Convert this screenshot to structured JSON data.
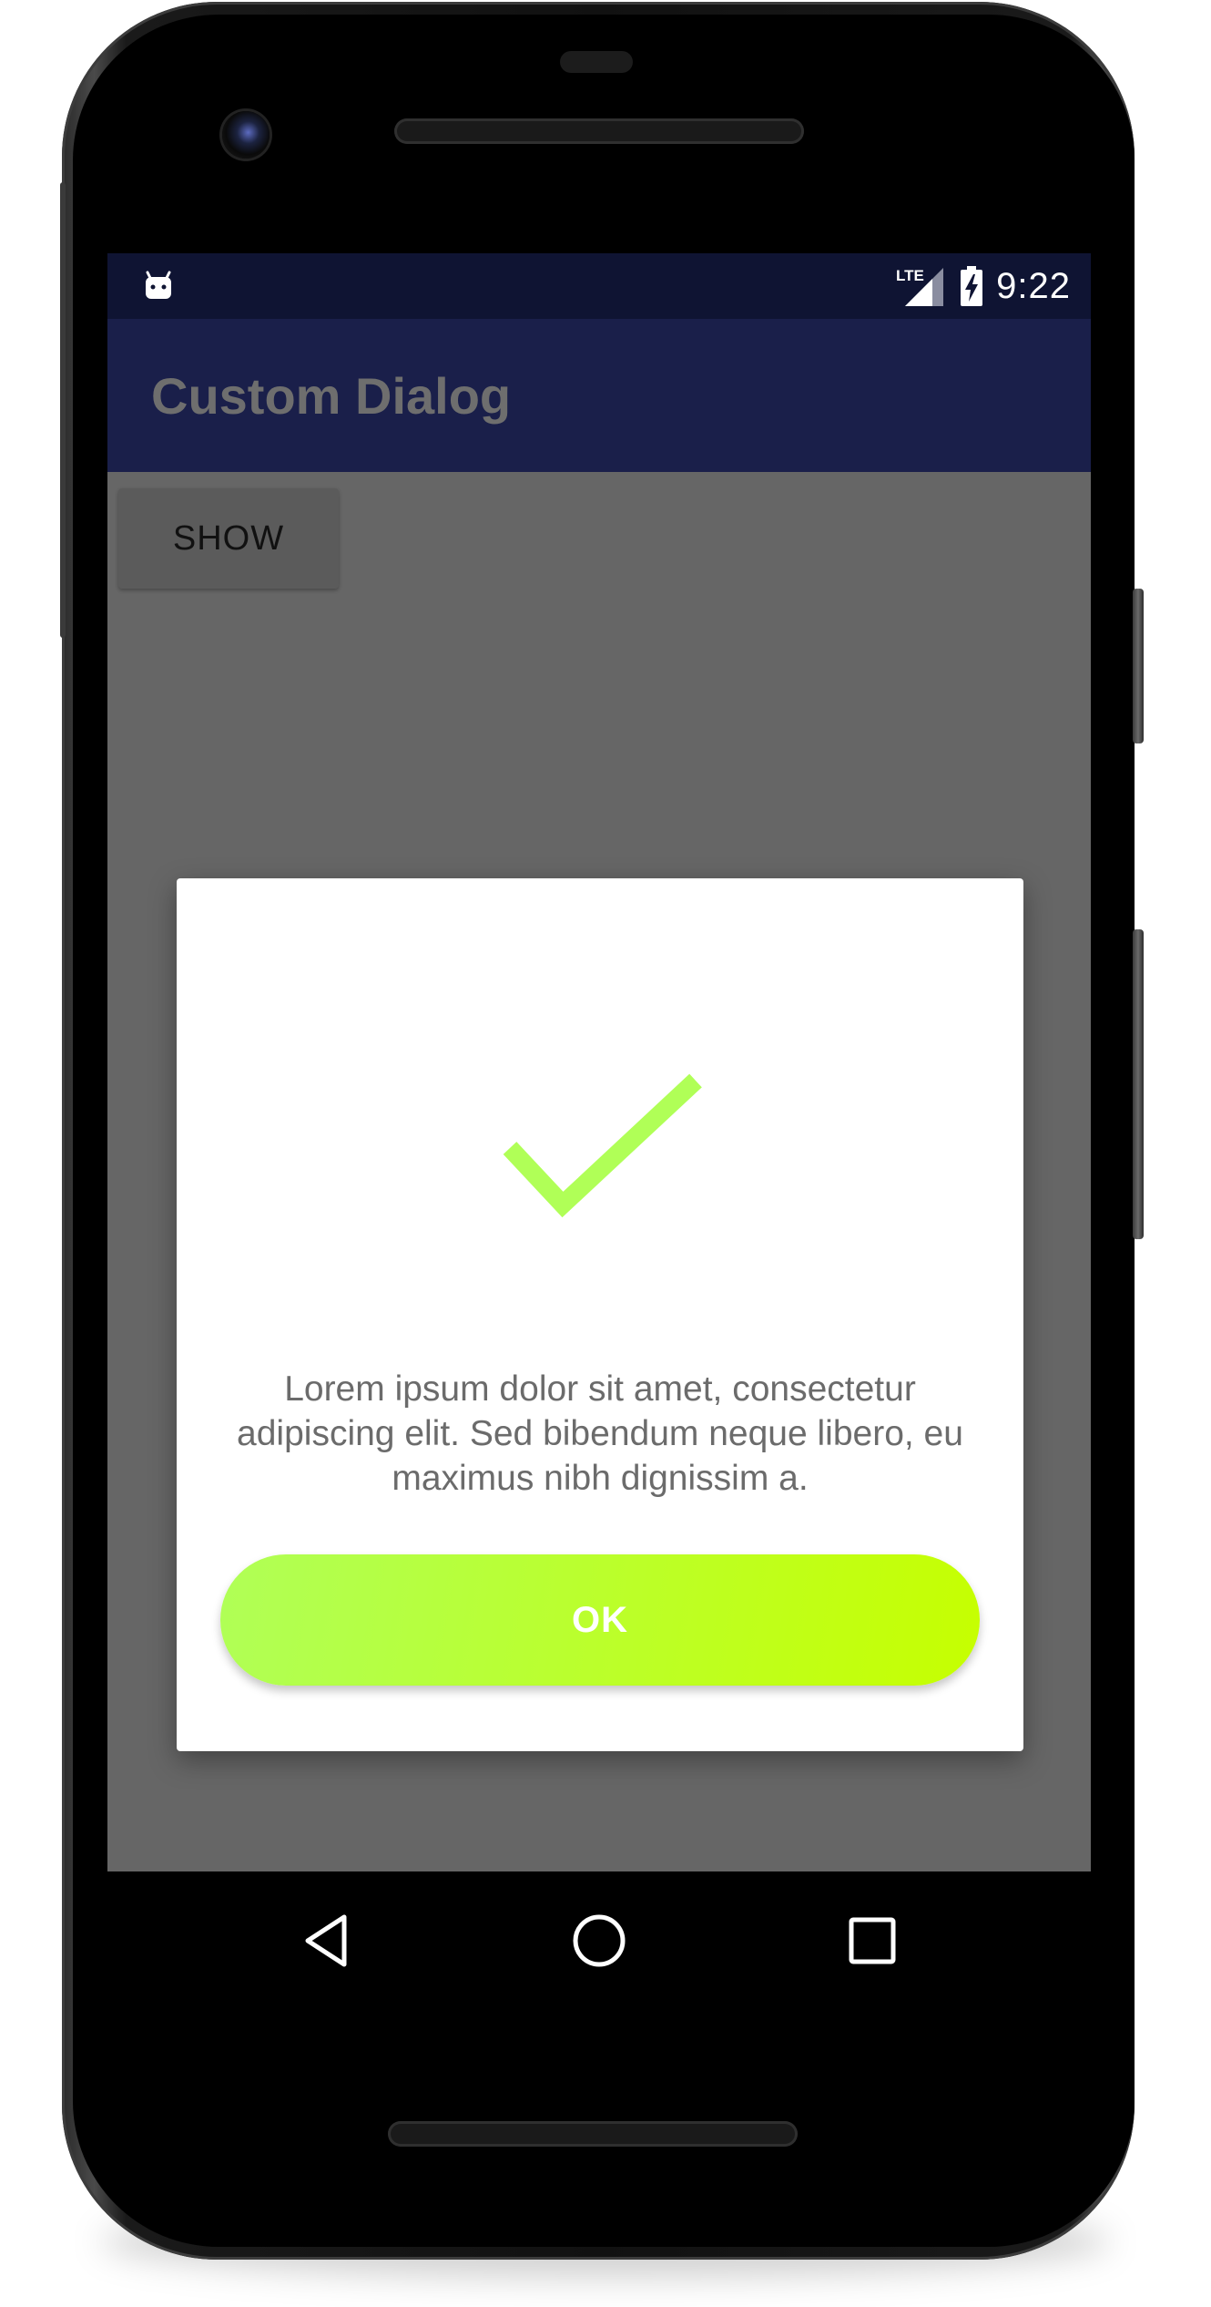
{
  "status_bar": {
    "network": "LTE",
    "time": "9:22",
    "icons": [
      "android-bot-icon",
      "lte-signal-icon",
      "battery-charging-icon"
    ]
  },
  "app_bar": {
    "title": "Custom Dialog"
  },
  "content": {
    "show_button_label": "SHOW"
  },
  "dialog": {
    "icon": "checkmark-icon",
    "icon_color": "#b0ff57",
    "message": "Lorem ipsum dolor sit amet, consectetur adipiscing elit. Sed bibendum neque libero, eu maximus nibh dignissim a.",
    "ok_label": "OK",
    "ok_gradient": [
      "#b0ff57",
      "#c6ff00"
    ]
  },
  "nav_bar": {
    "icons": [
      "back-icon",
      "home-icon",
      "recents-icon"
    ]
  },
  "colors": {
    "status_bar": "#0f1433",
    "app_bar": "#1a1f4a",
    "scrim_background": "#666666"
  }
}
